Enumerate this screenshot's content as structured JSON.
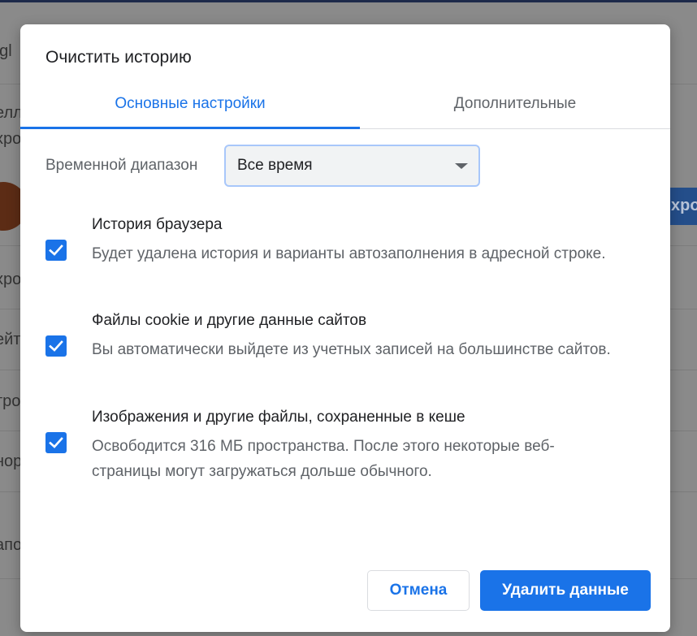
{
  "background": {
    "fragments": [
      "ogl",
      "елл",
      "хро",
      "хро",
      "ейт",
      "тро",
      "нор",
      "апо"
    ],
    "button_text": "хрон"
  },
  "dialog": {
    "title": "Очистить историю",
    "tabs": [
      {
        "label": "Основные настройки",
        "active": true
      },
      {
        "label": "Дополнительные",
        "active": false
      }
    ],
    "time_range": {
      "label": "Временной диапазон",
      "selected": "Все время"
    },
    "options": [
      {
        "title": "История браузера",
        "description": "Будет удалена история и варианты автозаполнения в адресной строке.",
        "checked": true
      },
      {
        "title": "Файлы cookie и другие данные сайтов",
        "description": "Вы автоматически выйдете из учетных записей на большинстве сайтов.",
        "checked": true
      },
      {
        "title": "Изображения и другие файлы, сохраненные в кеше",
        "description": "Освободится 316 МБ пространства. После этого некоторые веб-страницы могут загружаться дольше обычного.",
        "checked": true
      }
    ],
    "buttons": {
      "cancel": "Отмена",
      "delete": "Удалить данные"
    }
  },
  "colors": {
    "accent": "#1a73e8",
    "text_primary": "#202124",
    "text_secondary": "#5f6368"
  }
}
